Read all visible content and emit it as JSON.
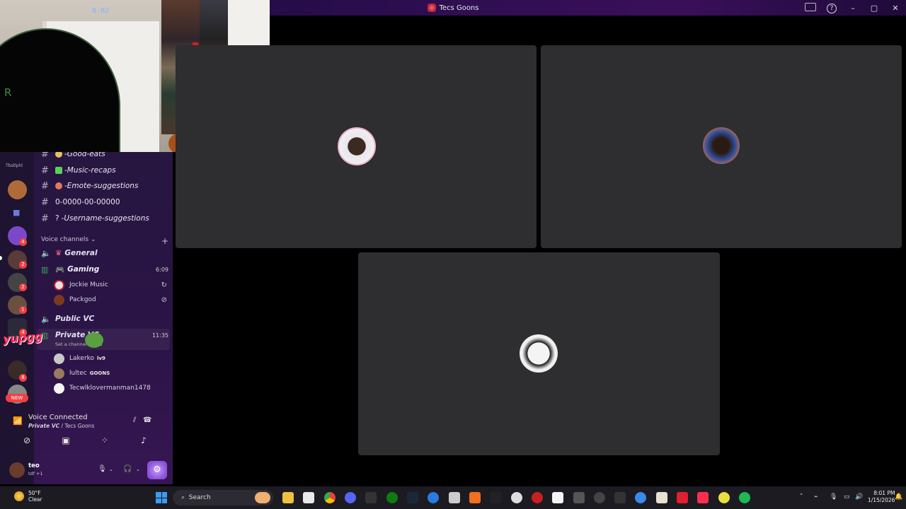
{
  "window": {
    "title": "Tecs Goons"
  },
  "webcam": {
    "clock": "8:02",
    "letter": "R"
  },
  "rail": {
    "small_label": "Tbstlphl",
    "new_badge": "NEW",
    "badges": [
      "4",
      "2",
      "2",
      "1",
      "4",
      "8"
    ]
  },
  "channels": {
    "text": [
      {
        "name": "-Good-eats"
      },
      {
        "name": "-Music-recaps"
      },
      {
        "name": "-Emote-suggestions"
      },
      {
        "name": "0-0000-00-00000"
      },
      {
        "name": "-Username-suggestions",
        "prefix": "?"
      }
    ],
    "section_label": "Voice channels",
    "voice": [
      {
        "name": "General"
      },
      {
        "name": "Gaming",
        "time": "6:09"
      },
      {
        "name": "Public VC"
      },
      {
        "name": "Private VC",
        "time": "11:35"
      }
    ],
    "gaming_users": [
      "Jockie Music",
      "Packgod"
    ],
    "private_sub": "Set a channel status",
    "private_users": [
      {
        "name": "Lakerko",
        "tag": "lv9"
      },
      {
        "name": "lultec",
        "tag": "GOONS"
      },
      {
        "name": "Tecwlklovermanman1478",
        "tag": ""
      }
    ]
  },
  "voice_panel": {
    "status": "Voice Connected",
    "channel": "Private VC",
    "server": "Tecs Goons"
  },
  "userbar": {
    "name": "teo",
    "status": "tdf +1"
  },
  "sticker": {
    "text": "yupgg"
  },
  "taskbar": {
    "temperature": "50°F",
    "condition": "Clear",
    "search_placeholder": "Search",
    "time": "8:01 PM",
    "date": "1/15/2026"
  },
  "colors": {
    "accent": "#8b52d8",
    "danger": "#f23f43",
    "tile": "#2e2d2f"
  }
}
